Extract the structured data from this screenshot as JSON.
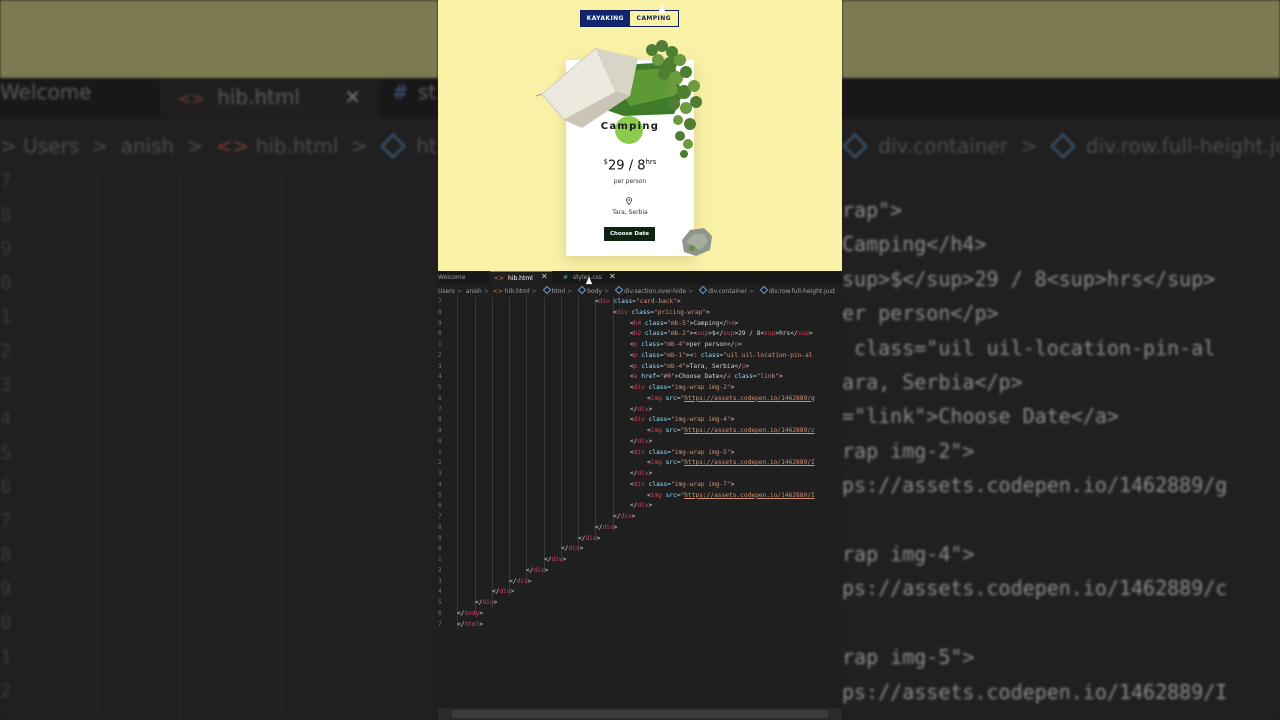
{
  "preview": {
    "tabs": [
      {
        "label": "KAYAKING",
        "active": true
      },
      {
        "label": "CAMPING",
        "active": false
      }
    ],
    "card": {
      "title": "Camping",
      "currency": "$",
      "price": "29 / 8",
      "unit": "hrs",
      "per": "per person",
      "location": "Tara, Serbia",
      "cta": "Choose Date"
    },
    "colors": {
      "background": "#f9f1a5",
      "accent": "#0f2570",
      "button": "#0d2410"
    }
  },
  "editor": {
    "tabs": [
      {
        "label": "Welcome",
        "icon": "info-icon"
      },
      {
        "label": "hib.html",
        "icon": "html-file-icon",
        "active": true,
        "close": "✕"
      },
      {
        "label": "styles.css",
        "icon": "css-file-icon",
        "close": "✕"
      }
    ],
    "breadcrumb": [
      "Users",
      "anish",
      "hib.html",
      "html",
      "body",
      "div.section.over-hide",
      "div.container",
      "div.row.full-height.just"
    ],
    "line_numbers": [
      "7",
      "8",
      "9",
      "0",
      "1",
      "2",
      "3",
      "4",
      "5",
      "6",
      "7",
      "8",
      "9",
      "0",
      "1",
      "2",
      "3",
      "4",
      "5",
      "6",
      "7",
      "8",
      "9",
      "0",
      "1",
      "2",
      "3",
      "4",
      "5",
      "6",
      "7"
    ],
    "code_lines": [
      {
        "o": "<",
        "t": "div",
        "a": " class=",
        "s": "\"card-back\"",
        "c": ">"
      },
      {
        "o": "<",
        "t": "div",
        "a": " class=",
        "s": "\"pricing-wrap\"",
        "c": ">"
      },
      {
        "o": "<",
        "t": "h4",
        "a": " class=",
        "s": "\"mb-5\"",
        "c": ">Camping</",
        "t2": "h4",
        "c2": ">"
      },
      {
        "o": "<",
        "t": "h2",
        "a": " class=",
        "s": "\"mb-2\"",
        "c": "><",
        "t2": "sup",
        "c2": ">$</",
        "t3": "sup",
        "c3": ">29 / 8<",
        "t4": "sup",
        "c4": ">hrs</",
        "t5": "sup",
        "c5": ">"
      },
      {
        "o": "<",
        "t": "p",
        "a": " class=",
        "s": "\"mb-4\"",
        "c": ">per person</",
        "t2": "p",
        "c2": ">"
      },
      {
        "o": "<",
        "t": "p",
        "a": " class=",
        "s": "\"mb-1\"",
        "c": "><",
        "t2": "i",
        "a2": " class=",
        "s2": "\"uil uil-location-pin-al"
      },
      {
        "o": "<",
        "t": "p",
        "a": " class=",
        "s": "\"mb-4\"",
        "c": ">Tara, Serbia</",
        "t2": "p",
        "c2": ">"
      },
      {
        "o": "<",
        "t": "a",
        "a": " href=",
        "s": "\"#0\"",
        "a2": " class=",
        "s2": "\"link\"",
        "c": ">Choose Date</",
        "t2": "a",
        "c2": ">"
      },
      {
        "o": "<",
        "t": "div",
        "a": " class=",
        "s": "\"img-wrap img-2\"",
        "c": ">"
      },
      {
        "o": "<",
        "t": "img",
        "a": " src=",
        "s": "\"",
        "u": "https://assets.codepen.io/1462889/g"
      },
      {
        "o": "</",
        "t": "div",
        "c": ">"
      },
      {
        "o": "<",
        "t": "div",
        "a": " class=",
        "s": "\"img-wrap img-4\"",
        "c": ">"
      },
      {
        "o": "<",
        "t": "img",
        "a": " src=",
        "s": "\"",
        "u": "https://assets.codepen.io/1462889/c"
      },
      {
        "o": "</",
        "t": "div",
        "c": ">"
      },
      {
        "o": "<",
        "t": "div",
        "a": " class=",
        "s": "\"img-wrap img-5\"",
        "c": ">"
      },
      {
        "o": "<",
        "t": "img",
        "a": " src=",
        "s": "\"",
        "u": "https://assets.codepen.io/1462889/I"
      },
      {
        "o": "</",
        "t": "div",
        "c": ">"
      },
      {
        "o": "<",
        "t": "div",
        "a": " class=",
        "s": "\"img-wrap img-7\"",
        "c": ">"
      },
      {
        "o": "<",
        "t": "img",
        "a": " src=",
        "s": "\"",
        "u": "https://assets.codepen.io/1462889/I"
      },
      {
        "o": "</",
        "t": "div",
        "c": ">"
      },
      {
        "o": "</",
        "t": "div",
        "c": ">"
      },
      {
        "o": "</",
        "t": "div",
        "c": ">"
      },
      {
        "o": "</",
        "t": "div",
        "c": ">"
      },
      {
        "o": "</",
        "t": "div",
        "c": ">"
      },
      {
        "o": "</",
        "t": "div",
        "c": ">"
      },
      {
        "o": "</",
        "t": "div",
        "c": ">"
      },
      {
        "o": "</",
        "t": "div",
        "c": ">"
      },
      {
        "o": "</",
        "t": "div",
        "c": ">"
      },
      {
        "o": "</",
        "t": "div",
        "c": ">"
      },
      {
        "o": "</",
        "t": "body",
        "c": ">"
      },
      {
        "o": "</",
        "t": "html",
        "c": ">"
      }
    ]
  },
  "background": {
    "tabs": [
      "Welcome",
      "hib.html",
      "st"
    ],
    "close": "✕",
    "breadcrumb_left": [
      "Users",
      "anish",
      "hib.html",
      "html"
    ],
    "breadcrumb_right": [
      "div.container",
      "div.row.full-height.just"
    ],
    "gutter": [
      "7",
      "8",
      "9",
      "0",
      "1",
      "2",
      "3",
      "4",
      "5",
      "6",
      "7",
      "8",
      "9",
      "0",
      "1",
      "2"
    ],
    "right_code": [
      "rap\">",
      "Camping</h4>",
      "sup>$</sup>29 / 8<sup>hrs</sup>",
      "er person</p>",
      " class=\"uil uil-location-pin-al",
      "ara, Serbia</p>",
      "=\"link\">Choose Date</a>",
      "rap img-2\">",
      "ps://assets.codepen.io/1462889/g",
      "",
      "rap img-4\">",
      "ps://assets.codepen.io/1462889/c",
      "",
      "rap img-5\">",
      "ps://assets.codepen.io/1462889/I"
    ]
  }
}
